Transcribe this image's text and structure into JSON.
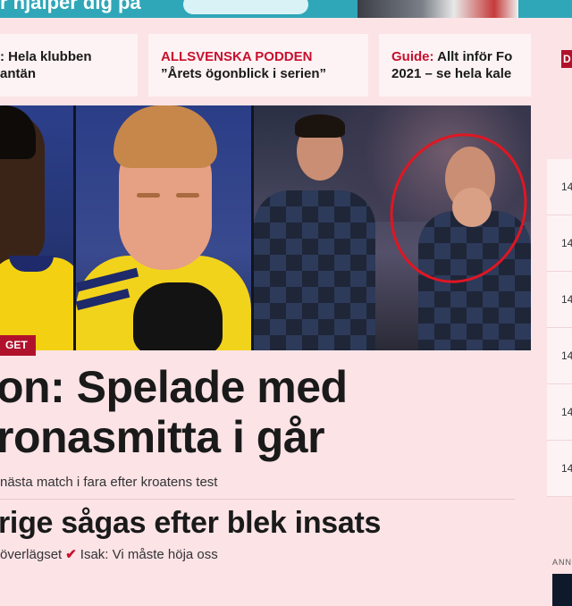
{
  "banner": {
    "text": "r hjälper dig på"
  },
  "top_cards": [
    {
      "kicker": "",
      "line1": ": Hela klubben",
      "line2": "antän"
    },
    {
      "kicker": "ALLSVENSKA PODDEN",
      "line1": "",
      "line2": "”Årets ögonblick i serien”"
    },
    {
      "kicker": "Guide:",
      "line1": " Allt inför Fo",
      "line2": "2021 – se hela kale"
    }
  ],
  "hero": {
    "badge": "GET"
  },
  "article": {
    "headline_line1": "on: Spelade med",
    "headline_line2": "ronasmitta i går",
    "subline": "nästa match i fara efter kroatens test",
    "headline2": "rige sågas efter blek insats",
    "related_1": "överlägset",
    "related_2": "Isak: Vi måste höja oss"
  },
  "sidebar": {
    "badge": "D",
    "times": [
      "14",
      "14",
      "14",
      "14",
      "14",
      "14"
    ],
    "footer": "ANN"
  },
  "colors": {
    "background": "#fbe3e6",
    "accent": "#c8102e",
    "badge": "#b0122c",
    "banner": "#2fa7b8"
  }
}
